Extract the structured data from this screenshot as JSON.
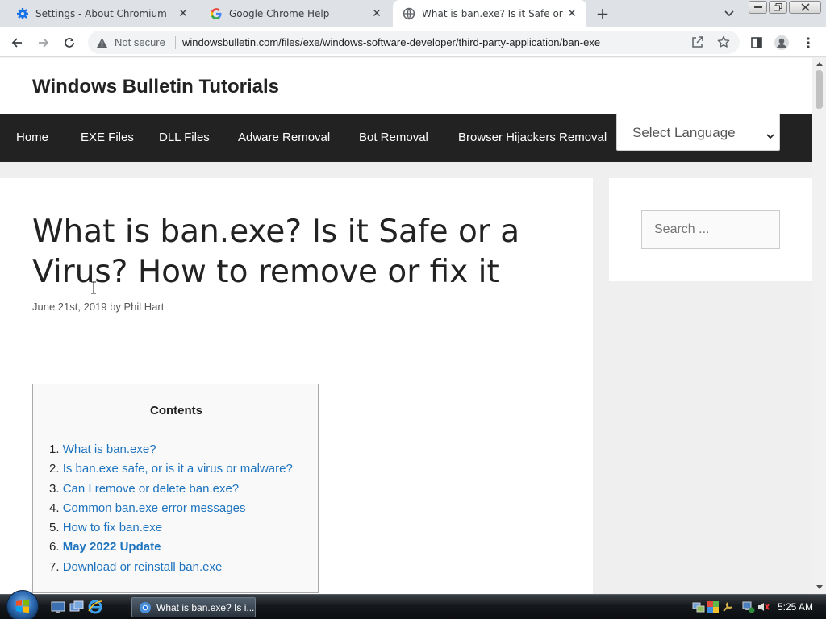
{
  "browser": {
    "tabs": [
      {
        "title": "Settings - About Chromium",
        "icon": "gear-icon",
        "active": false
      },
      {
        "title": "Google Chrome Help",
        "icon": "google-icon",
        "active": false
      },
      {
        "title": "What is ban.exe? Is it Safe or a Vi",
        "icon": "globe-icon",
        "active": true
      }
    ],
    "omnibox": {
      "security_label": "Not secure",
      "url": "windowsbulletin.com/files/exe/windows-software-developer/third-party-application/ban-exe"
    }
  },
  "site": {
    "title": "Windows Bulletin Tutorials",
    "nav": [
      "Home",
      "EXE Files",
      "DLL Files",
      "Adware Removal",
      "Bot Removal",
      "Browser Hijackers Removal"
    ],
    "language_select": "Select Language"
  },
  "article": {
    "title": "What is ban.exe? Is it Safe or a Virus? How to remove or fix it",
    "date": "June 21st, 2019",
    "by": "by",
    "author": "Phil Hart",
    "toc": {
      "heading": "Contents",
      "items": [
        {
          "num": "1.",
          "text": "What is ban.exe?"
        },
        {
          "num": "2.",
          "text": "Is ban.exe safe, or is it a virus or malware?"
        },
        {
          "num": "3.",
          "text": "Can I remove or delete ban.exe?"
        },
        {
          "num": "4.",
          "text": "Common ban.exe error messages"
        },
        {
          "num": "5.",
          "text": "How to fix ban.exe"
        },
        {
          "num": "6.",
          "text": "May 2022 Update"
        },
        {
          "num": "7.",
          "text": "Download or reinstall ban.exe"
        }
      ]
    }
  },
  "sidebar": {
    "search_placeholder": "Search ..."
  },
  "taskbar": {
    "window_button": "What is ban.exe? Is i...",
    "clock": "5:25 AM"
  },
  "colors": {
    "nav_bg": "#222222",
    "link": "#1e73be",
    "tab_strip": "#dee1e6"
  }
}
